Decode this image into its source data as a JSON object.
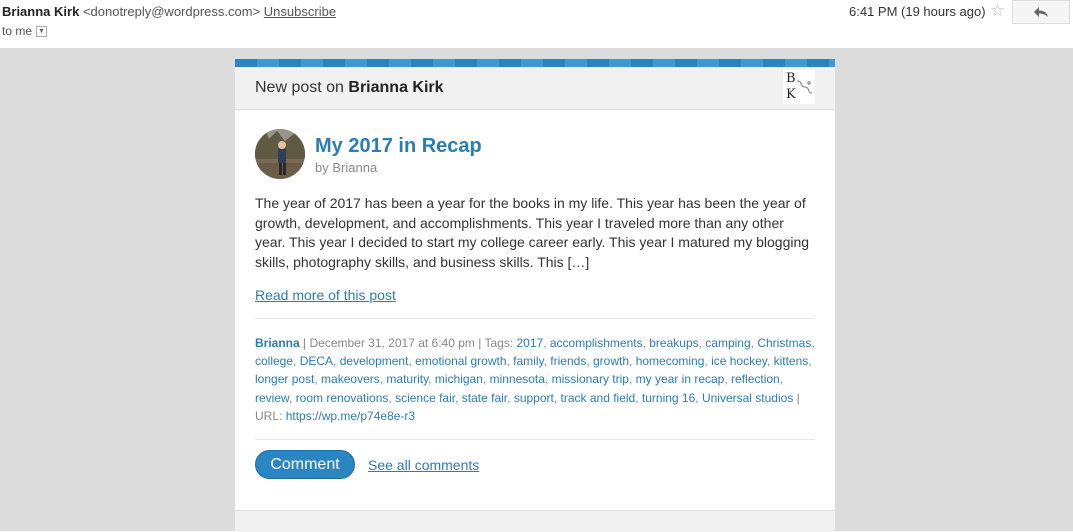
{
  "email": {
    "sender_name": "Brianna Kirk",
    "sender_email": "<donotreply@wordpress.com>",
    "unsubscribe": "Unsubscribe",
    "to": "to me",
    "time": "6:41 PM (19 hours ago)"
  },
  "card": {
    "new_post_prefix": "New post on",
    "blog_name": "Brianna Kirk",
    "logo_letters": [
      "B",
      "K"
    ],
    "post_title": "My 2017 in Recap",
    "by_prefix": "by",
    "author": "Brianna",
    "excerpt": "The year of 2017 has been a year for the books in my life. This year has been the year of growth, development, and accomplishments. This year I traveled more than any other year. This year I decided to start my college career early. This year I matured my blogging skills, photography skills, and business skills. This […]",
    "read_more": "Read more of this post",
    "meta_author": "Brianna",
    "meta_date": " | December 31, 2017 at 6:40 pm | Tags: ",
    "tags": [
      "2017",
      "accomplishments",
      "breakups",
      "camping",
      "Christmas",
      "college",
      "DECA",
      "development",
      "emotional growth",
      "family",
      "friends",
      "growth",
      "homecoming",
      "ice hockey",
      "kittens",
      "longer post",
      "makeovers",
      "maturity",
      "michigan",
      "minnesota",
      "missionary trip",
      "my year in recap",
      "reflection",
      "review",
      "room renovations",
      "science fair",
      "state fair",
      "support",
      "track and field",
      "turning 16",
      "Universal studios"
    ],
    "url_prefix": " | URL: ",
    "url": "https://wp.me/p74e8e-r3",
    "comment_button": "Comment",
    "see_all": "See all comments"
  },
  "colors": {
    "accent": "#2a86c3",
    "link": "#2a7db5",
    "background": "#dcdcdc"
  }
}
